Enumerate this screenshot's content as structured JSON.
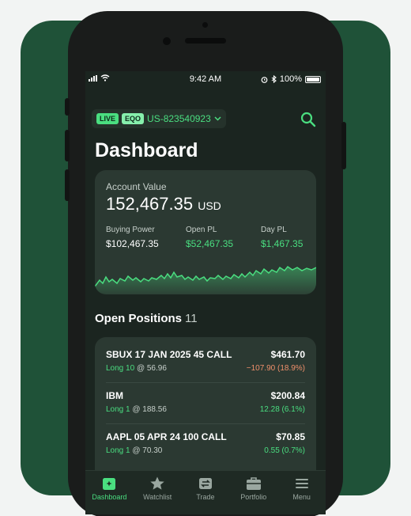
{
  "status": {
    "time": "9:42 AM",
    "battery": "100%"
  },
  "account": {
    "live": "LIVE",
    "type": "EQO",
    "id": "US-823540923"
  },
  "page": {
    "title": "Dashboard"
  },
  "summary": {
    "label": "Account Value",
    "value": "152,467.35",
    "currency": "USD",
    "buying_power_label": "Buying Power",
    "buying_power": "$102,467.35",
    "open_pl_label": "Open PL",
    "open_pl": "$52,467.35",
    "day_pl_label": "Day PL",
    "day_pl": "$1,467.35"
  },
  "positions": {
    "title": "Open Positions",
    "count": "11",
    "rows": [
      {
        "symbol": "SBUX 17 JAN 2025 45 CALL",
        "side": "Long 10",
        "cost": "@ 56.96",
        "price": "$461.70",
        "change": "−107.90 (18.9%)",
        "change_color": "#f0906b"
      },
      {
        "symbol": "IBM",
        "side": "Long 1",
        "cost": "@ 188.56",
        "price": "$200.84",
        "change": "12.28 (6.1%)",
        "change_color": "#4ade80"
      },
      {
        "symbol": "AAPL 05 APR 24 100 CALL",
        "side": "Long 1",
        "cost": "@ 70.30",
        "price": "$70.85",
        "change": "0.55 (0.7%)",
        "change_color": "#4ade80"
      }
    ]
  },
  "tabs": [
    {
      "label": "Dashboard",
      "icon": "dashboard-icon",
      "active": true
    },
    {
      "label": "Watchlist",
      "icon": "star-icon",
      "active": false
    },
    {
      "label": "Trade",
      "icon": "trade-icon",
      "active": false
    },
    {
      "label": "Portfolio",
      "icon": "briefcase-icon",
      "active": false
    },
    {
      "label": "Menu",
      "icon": "menu-icon",
      "active": false
    }
  ],
  "colors": {
    "accent": "#4ade80",
    "negative": "#f0906b",
    "brand_bg": "#1f5238"
  }
}
